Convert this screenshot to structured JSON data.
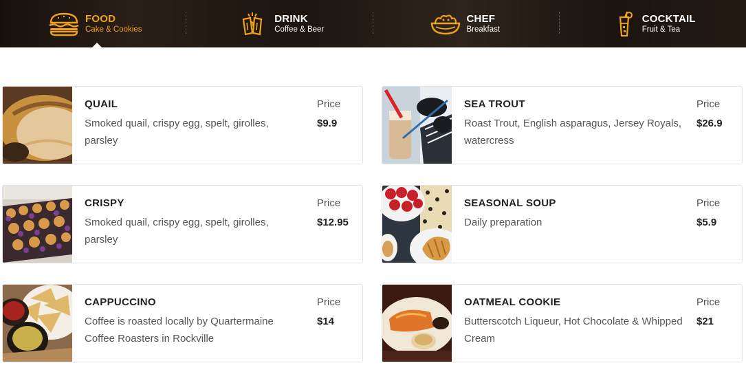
{
  "tabs": [
    {
      "title": "FOOD",
      "subtitle": "Cake & Cookies",
      "icon": "burger-icon",
      "active": true
    },
    {
      "title": "DRINK",
      "subtitle": "Coffee & Beer",
      "icon": "beer-mugs-icon",
      "active": false
    },
    {
      "title": "CHEF",
      "subtitle": "Breakfast",
      "icon": "salad-bowl-icon",
      "active": false
    },
    {
      "title": "COCKTAIL",
      "subtitle": "Fruit & Tea",
      "icon": "cocktail-glass-icon",
      "active": false
    }
  ],
  "accent_color": "#f0a21a",
  "price_label": "Price",
  "menu": [
    {
      "name": "QUAIL",
      "description": "Smoked quail, crispy egg, spelt, girolles, parsley",
      "price": "$9.9",
      "image": "bread-photo"
    },
    {
      "name": "SEA TROUT",
      "description": "Roast Trout, English asparagus, Jersey Royals, watercress",
      "price": "$26.9",
      "image": "drink-sunglasses-photo"
    },
    {
      "name": "CRISPY",
      "description": "Smoked quail, crispy egg, spelt, girolles, parsley",
      "price": "$12.95",
      "image": "pastries-photo"
    },
    {
      "name": "SEASONAL SOUP",
      "description": "Daily preparation",
      "price": "$5.9",
      "image": "strawberries-croissant-photo"
    },
    {
      "name": "CAPPUCCINO",
      "description": "Coffee is roasted locally by Quartermaine Coffee Roasters in Rockville",
      "price": "$14",
      "image": "chips-dip-photo"
    },
    {
      "name": "OATMEAL COOKIE",
      "description": "Butterscotch Liqueur, Hot Chocolate & Whipped Cream",
      "price": "$21",
      "image": "dessert-plate-photo"
    }
  ]
}
